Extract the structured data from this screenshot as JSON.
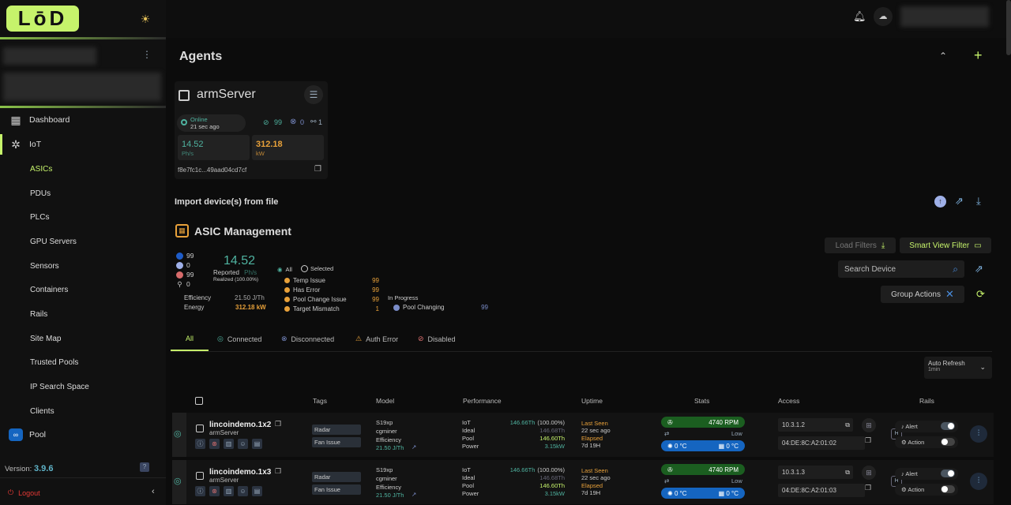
{
  "app": {
    "logo": "LōD",
    "version_label": "Version:",
    "version": "3.9.6",
    "logout": "Logout"
  },
  "sidebar": {
    "items": [
      {
        "label": "Dashboard",
        "icon": "grid-icon"
      },
      {
        "label": "IoT",
        "icon": "network-icon"
      },
      {
        "label": "Pool",
        "icon": "pool-icon"
      }
    ],
    "iot_sub": [
      "ASICs",
      "PDUs",
      "PLCs",
      "GPU Servers",
      "Sensors",
      "Containers",
      "Rails",
      "Site Map",
      "Trusted Pools",
      "IP Search Space",
      "Clients"
    ],
    "active_sub": "ASICs"
  },
  "agents": {
    "title": "Agents",
    "card": {
      "name": "armServer",
      "status": "Online",
      "ago": "21 sec ago",
      "ok_count": "99",
      "err_count": "0",
      "link_count": "1",
      "hashrate": "14.52",
      "hashrate_unit": "Ph/s",
      "power": "312.18",
      "power_unit": "kW",
      "id": "f8e7fc1c...49aad04cd7cf"
    }
  },
  "import": {
    "title": "Import device(s) from file"
  },
  "asic": {
    "title": "ASIC Management",
    "counts": [
      "99",
      "0",
      "99",
      "0"
    ],
    "reported_value": "14.52",
    "reported_label": "Reported",
    "reported_unit": "Ph/s",
    "realized_label": "Realized",
    "realized_pct": "(100.00%)",
    "efficiency_label": "Efficiency",
    "efficiency_value": "21.50 J/Th",
    "energy_label": "Energy",
    "energy_value": "312.18 kW",
    "filter_all": "All",
    "filter_selected": "Selected",
    "issues": [
      {
        "label": "Temp Issue",
        "value": "99"
      },
      {
        "label": "Has Error",
        "value": "99"
      },
      {
        "label": "Pool Change Issue",
        "value": "99"
      },
      {
        "label": "Target Mismatch",
        "value": "1"
      }
    ],
    "in_progress_label": "In Progress",
    "pool_changing_label": "Pool Changing",
    "pool_changing_value": "99",
    "load_filters": "Load Filters",
    "smart_view_filter": "Smart View Filter",
    "search_placeholder": "Search Device",
    "group_actions": "Group Actions"
  },
  "tabs": [
    {
      "label": "All",
      "icon": ""
    },
    {
      "label": "Connected",
      "icon": "check-circle-icon"
    },
    {
      "label": "Disconnected",
      "icon": "x-circle-icon"
    },
    {
      "label": "Auth Error",
      "icon": "auth-error-icon"
    },
    {
      "label": "Disabled",
      "icon": "disabled-icon"
    }
  ],
  "auto_refresh": {
    "label": "Auto Refresh",
    "value": "1min"
  },
  "columns": [
    "Tags",
    "Model",
    "Performance",
    "Uptime",
    "Stats",
    "Access",
    "Rails"
  ],
  "rows": [
    {
      "name": "lincoindemo.1x2",
      "agent": "armServer",
      "tags": [
        "Radar",
        "Fan Issue"
      ],
      "model": "S19xp",
      "miner": "cgminer",
      "eff_label": "Efficiency",
      "eff": "21.50 J/Th",
      "perf": [
        {
          "k": "IoT",
          "v": "146.66Th",
          "extra": "(100.00%)"
        },
        {
          "k": "Ideal",
          "v": "146.68Th",
          "extra": ""
        },
        {
          "k": "Pool",
          "v": "146.60Th",
          "extra": ""
        },
        {
          "k": "Power",
          "v": "3.15kW",
          "extra": ""
        }
      ],
      "last_seen_label": "Last Seen",
      "last_seen": "22 sec ago",
      "elapsed_label": "Elapsed",
      "elapsed": "7d 19H",
      "fan": "4740 RPM",
      "fan_state": "Low",
      "temp1": "0 °C",
      "temp2": "0 °C",
      "ip": "10.3.1.2",
      "mac": "04:DE:8C:A2:01:02",
      "alert": "Alert",
      "action": "Action"
    },
    {
      "name": "lincoindemo.1x3",
      "agent": "armServer",
      "tags": [
        "Radar",
        "Fan Issue"
      ],
      "model": "S19xp",
      "miner": "cgminer",
      "eff_label": "Efficiency",
      "eff": "21.50 J/Th",
      "perf": [
        {
          "k": "IoT",
          "v": "146.66Th",
          "extra": "(100.00%)"
        },
        {
          "k": "Ideal",
          "v": "146.68Th",
          "extra": ""
        },
        {
          "k": "Pool",
          "v": "146.60Th",
          "extra": ""
        },
        {
          "k": "Power",
          "v": "3.15kW",
          "extra": ""
        }
      ],
      "last_seen_label": "Last Seen",
      "last_seen": "22 sec ago",
      "elapsed_label": "Elapsed",
      "elapsed": "7d 19H",
      "fan": "4740 RPM",
      "fan_state": "Low",
      "temp1": "0 °C",
      "temp2": "0 °C",
      "ip": "10.3.1.3",
      "mac": "04:DE:8C:A2:01:03",
      "alert": "Alert",
      "action": "Action"
    }
  ],
  "colors": {
    "accent": "#c6f36b",
    "teal": "#4fb3a0",
    "orange": "#e8a13a",
    "blue": "#1565c0",
    "green_pill": "#1b5e20"
  }
}
